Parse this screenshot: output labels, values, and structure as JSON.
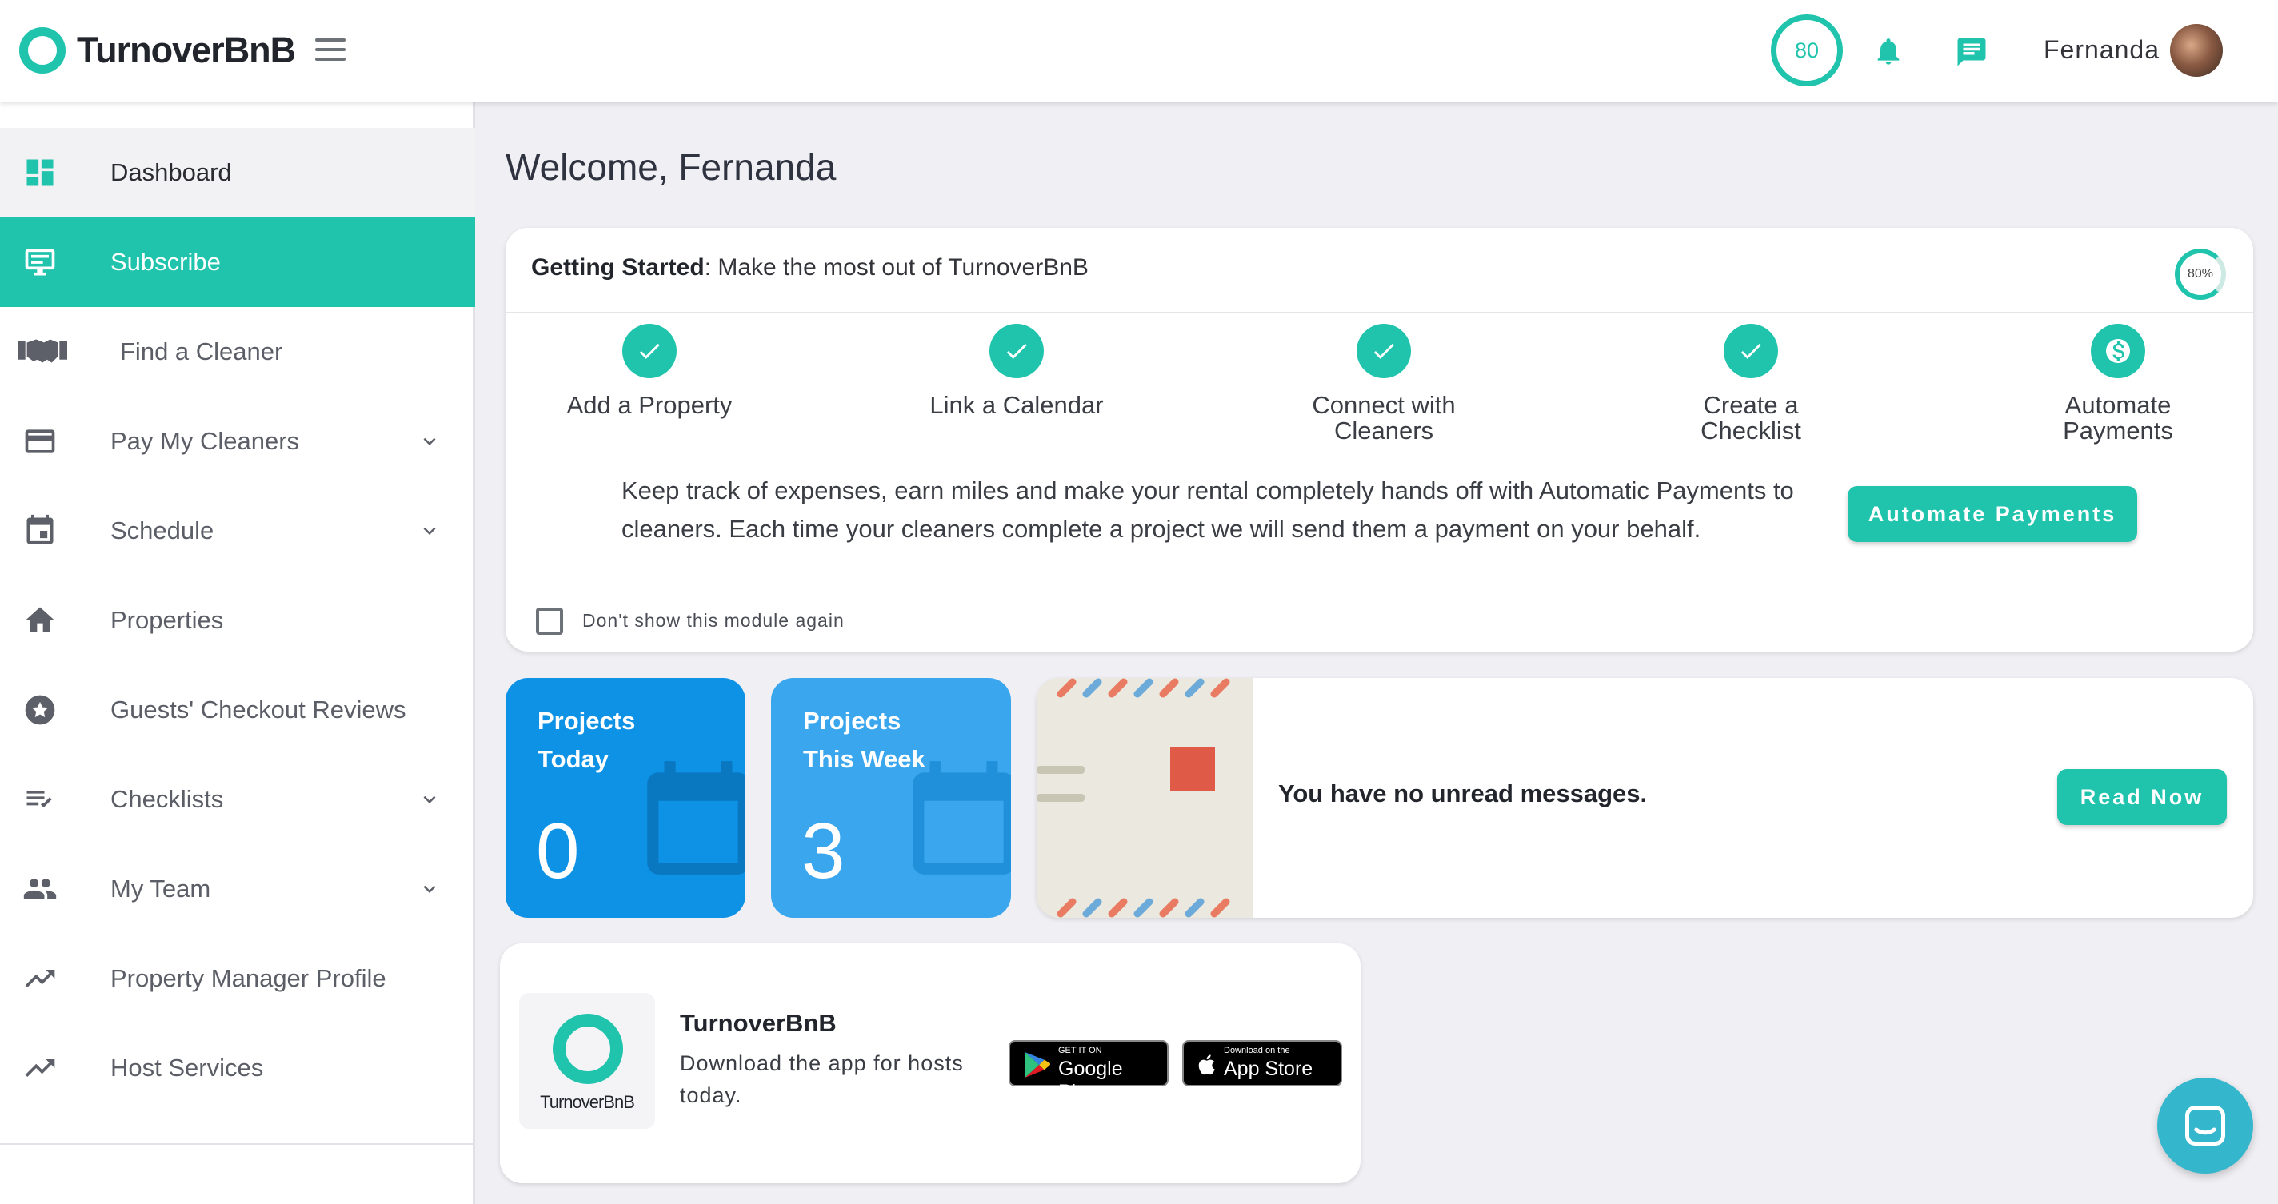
{
  "brand": {
    "name": "TurnoverBnB",
    "accent": "#20c4ad"
  },
  "header": {
    "score": "80",
    "user_name": "Fernanda"
  },
  "sidebar": {
    "items": [
      {
        "label": "Dashboard",
        "icon": "dashboard-icon"
      },
      {
        "label": "Subscribe",
        "icon": "subscribe-icon"
      },
      {
        "label": "Find a Cleaner",
        "icon": "handshake-icon"
      },
      {
        "label": "Pay My Cleaners",
        "icon": "credit-card-icon"
      },
      {
        "label": "Schedule",
        "icon": "calendar-icon"
      },
      {
        "label": "Properties",
        "icon": "home-icon"
      },
      {
        "label": "Guests' Checkout Reviews",
        "icon": "star-icon"
      },
      {
        "label": "Checklists",
        "icon": "checklist-icon"
      },
      {
        "label": "My Team",
        "icon": "team-icon"
      },
      {
        "label": "Property Manager Profile",
        "icon": "trending-icon"
      },
      {
        "label": "Host Services",
        "icon": "trending-icon"
      }
    ]
  },
  "main": {
    "welcome": "Welcome, Fernanda",
    "getting_started": {
      "title_bold": "Getting Started",
      "title_rest": ": Make the most out of TurnoverBnB",
      "progress": "80%",
      "steps": [
        {
          "line1": "Add a Property",
          "line2": ""
        },
        {
          "line1": "Link a Calendar",
          "line2": ""
        },
        {
          "line1": "Connect with",
          "line2": "Cleaners"
        },
        {
          "line1": "Create a",
          "line2": "Checklist"
        },
        {
          "line1": "Automate",
          "line2": "Payments"
        }
      ],
      "description": "Keep track of expenses, earn miles and make your rental completely hands off with Automatic Payments to cleaners. Each time your cleaners complete a project we will send them a payment on your behalf.",
      "button": "Automate Payments",
      "checkbox_label": "Don't show this module again"
    },
    "tiles": [
      {
        "line1": "Projects",
        "line2": "Today",
        "value": "0",
        "color": "#0e92e6"
      },
      {
        "line1": "Projects",
        "line2": "This Week",
        "value": "3",
        "color": "#3aa6ee"
      }
    ],
    "messages": {
      "text": "You have no unread messages.",
      "button": "Read Now"
    },
    "app": {
      "logo_text": "TurnoverBnB",
      "name": "TurnoverBnB",
      "description": "Download the app for hosts today.",
      "google_small": "GET IT ON",
      "google_big": "Google Play",
      "apple_small": "Download on the",
      "apple_big": "App Store"
    }
  }
}
